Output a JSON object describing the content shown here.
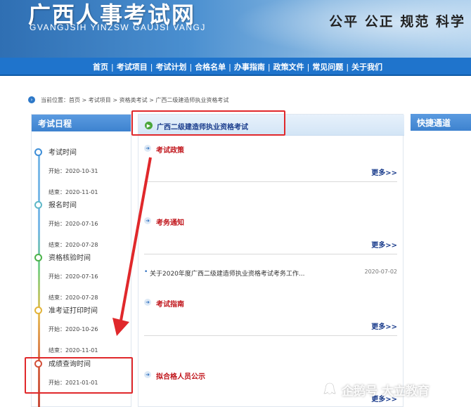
{
  "site": {
    "title": "广西人事考试网",
    "subtitle": "GVANGJSIH YINZSW GAUJSI VANGJ",
    "slogan": "公平 公正 规范 科学"
  },
  "nav": {
    "items": [
      {
        "label": "首页"
      },
      {
        "label": "考试项目"
      },
      {
        "label": "考试计划"
      },
      {
        "label": "合格名单"
      },
      {
        "label": "办事指南"
      },
      {
        "label": "政策文件"
      },
      {
        "label": "常见问题"
      },
      {
        "label": "关于我们"
      }
    ]
  },
  "breadcrumb": {
    "prefix": "当前位置：",
    "path": "首页 > 考试项目 > 资格类考试 > 广西二级建造师执业资格考试"
  },
  "schedule": {
    "heading": "考试日程",
    "items": [
      {
        "title": "考试时间",
        "start": "开始：2020-10-31",
        "end": "结束：2020-11-01",
        "color": "#3f8fd8"
      },
      {
        "title": "报名时间",
        "start": "开始：2020-07-16",
        "end": "结束：2020-07-28",
        "color": "#5fb8c8"
      },
      {
        "title": "资格核验时间",
        "start": "开始：2020-07-16",
        "end": "结束：2020-07-28",
        "color": "#4cb34c"
      },
      {
        "title": "准考证打印时间",
        "start": "开始：2020-10-26",
        "end": "结束：2020-11-01",
        "color": "#e2b43a"
      },
      {
        "title": "成绩查询时间",
        "start": "开始：2021-01-01",
        "end": "",
        "color": "#d3503a"
      }
    ]
  },
  "main": {
    "exam_title": "广西二级建造师执业资格考试",
    "more_label": "更多>>",
    "sections": [
      {
        "title": "考试政策"
      },
      {
        "title": "考务通知"
      },
      {
        "title": "考试指南"
      },
      {
        "title": "拟合格人员公示"
      }
    ],
    "news": [
      {
        "text": "关于2020年度广西二级建造师执业资格考试考务工作...",
        "date": "2020-07-02"
      }
    ]
  },
  "quick": {
    "heading": "快捷通道"
  },
  "watermark": {
    "text": "企鹅号 大立教育"
  },
  "colors": {
    "nav_bg": "#1f74cc",
    "highlight": "#e0282b",
    "section_title": "#c0141a",
    "link": "#1a3c8c"
  }
}
